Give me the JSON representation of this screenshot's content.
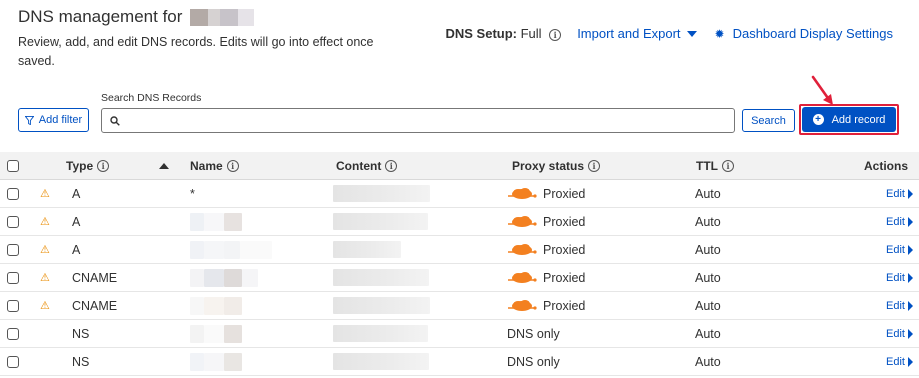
{
  "header": {
    "title": "DNS management for",
    "subtitle": "Review, add, and edit DNS records. Edits will go into effect once saved.",
    "dns_setup_label": "DNS Setup:",
    "dns_setup_value": "Full",
    "import_export": "Import and Export",
    "dashboard_settings": "Dashboard Display Settings"
  },
  "toolbar": {
    "add_filter": "Add filter",
    "search_label": "Search DNS Records",
    "search_value": "",
    "search_button": "Search",
    "add_record": "Add record"
  },
  "table": {
    "columns": {
      "type": "Type",
      "name": "Name",
      "content": "Content",
      "proxy": "Proxy status",
      "ttl": "TTL",
      "actions": "Actions"
    },
    "rows": [
      {
        "type": "A",
        "name": "*",
        "proxy": "Proxied",
        "ttl": "Auto",
        "edit": "Edit",
        "warning": true
      },
      {
        "type": "A",
        "name": "",
        "proxy": "Proxied",
        "ttl": "Auto",
        "edit": "Edit",
        "warning": true
      },
      {
        "type": "A",
        "name": "",
        "proxy": "Proxied",
        "ttl": "Auto",
        "edit": "Edit",
        "warning": true
      },
      {
        "type": "CNAME",
        "name": "",
        "proxy": "Proxied",
        "ttl": "Auto",
        "edit": "Edit",
        "warning": true
      },
      {
        "type": "CNAME",
        "name": "",
        "proxy": "Proxied",
        "ttl": "Auto",
        "edit": "Edit",
        "warning": true
      },
      {
        "type": "NS",
        "name": "",
        "proxy": "DNS only",
        "ttl": "Auto",
        "edit": "Edit",
        "warning": false
      },
      {
        "type": "NS",
        "name": "",
        "proxy": "DNS only",
        "ttl": "Auto",
        "edit": "Edit",
        "warning": false
      }
    ]
  },
  "colors": {
    "accent": "#0051c3",
    "highlight": "#e0203a",
    "warning": "#e98b00",
    "cloud": "#f38020"
  },
  "icons": {
    "info": "info-icon",
    "filter": "funnel-icon",
    "search": "search-icon",
    "add": "plus-circle-icon",
    "settings": "gear-icon",
    "warning": "warning-icon",
    "proxied": "cloud-icon"
  }
}
